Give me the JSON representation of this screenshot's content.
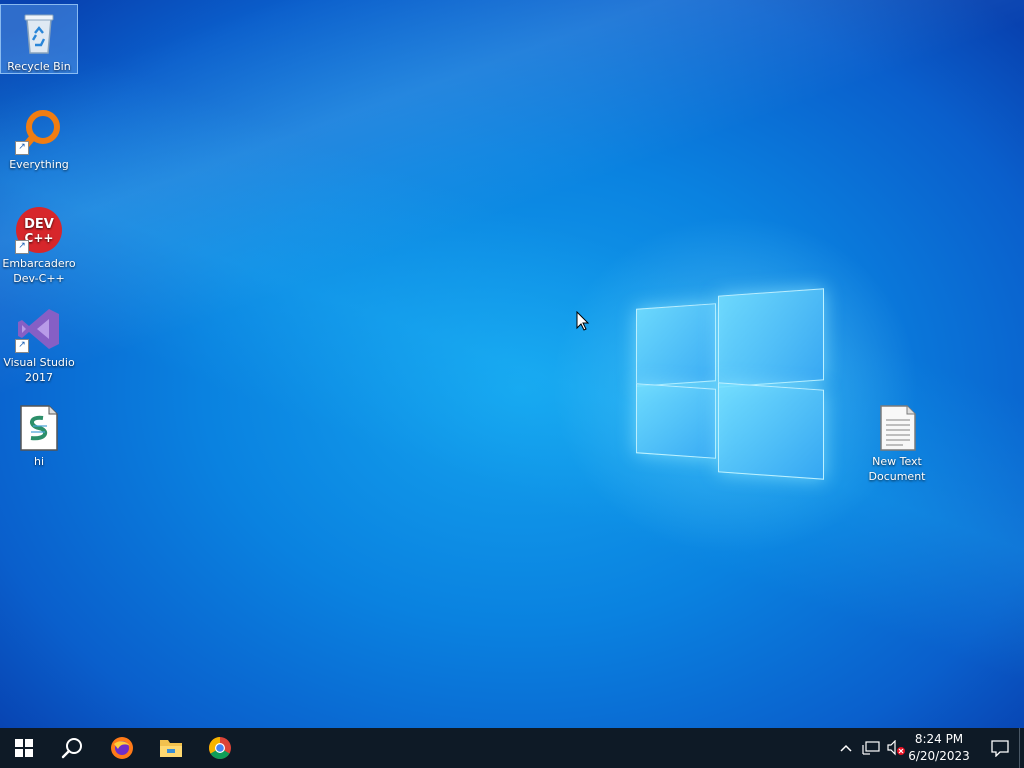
{
  "desktop": {
    "icons": [
      {
        "name": "recycle-bin",
        "label": "Recycle Bin",
        "icon": "recycle-bin-icon"
      },
      {
        "name": "everything",
        "label": "Everything",
        "icon": "magnifier-icon"
      },
      {
        "name": "dev-cpp",
        "label": "Embarcadero Dev-C++",
        "icon": "dev-cpp-icon",
        "logo_text": "DEV C++"
      },
      {
        "name": "visual-studio",
        "label": "Visual Studio 2017",
        "icon": "visual-studio-icon"
      },
      {
        "name": "hi-file",
        "label": "hi",
        "icon": "script-file-icon"
      },
      {
        "name": "new-text-document",
        "label": "New Text Document",
        "icon": "text-file-icon"
      }
    ]
  },
  "taskbar": {
    "start": "start-icon",
    "search": "search-icon",
    "pinned": [
      "firefox-icon",
      "file-explorer-icon",
      "chrome-icon"
    ],
    "tray": {
      "icons": [
        "chevron-up-icon",
        "network-icon",
        "volume-muted-icon"
      ],
      "time": "8:24 PM",
      "date": "6/20/2023",
      "notifications": "action-center-icon"
    }
  },
  "colors": {
    "taskbar": "#0e1a26",
    "desktop_accent": "#0a82e0"
  }
}
